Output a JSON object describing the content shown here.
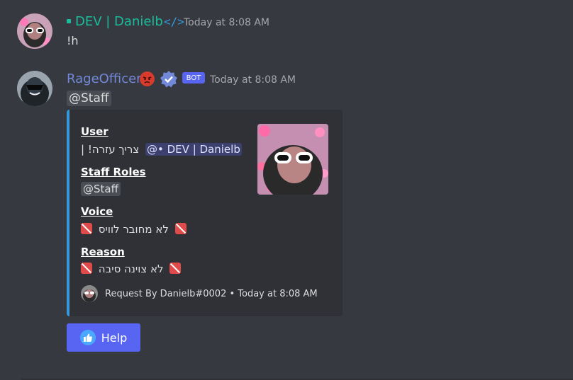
{
  "messages": [
    {
      "username": "DEV | Danielb",
      "username_color": "#1abc9c",
      "timestamp": "Today at 8:08 AM",
      "content": "!h",
      "badge_icon": "code-icon"
    },
    {
      "username": "RageOfficer",
      "username_color": "#7289da",
      "timestamp": "Today at 8:08 AM",
      "content_mention": "@Staff",
      "bot_tag": "BOT",
      "badge_icons": [
        "angry-face-icon",
        "verified-icon"
      ]
    }
  ],
  "embed": {
    "accent_color": "#3498db",
    "fields": [
      {
        "name": "User",
        "value_text": "צריך עזרה! |",
        "value_mention": "@• DEV | Danielb"
      },
      {
        "name": "Staff Roles",
        "value_mention": "@Staff"
      },
      {
        "name": "Voice",
        "value_text": "לא מחובר לוויס"
      },
      {
        "name": "Reason",
        "value_text": "לא צוינה סיבה"
      }
    ],
    "footer": "Request By Danielb#0002 • Today at 8:08 AM"
  },
  "button": {
    "label": "Help",
    "icon": "thumbs-up-icon",
    "color": "#5865f2"
  }
}
